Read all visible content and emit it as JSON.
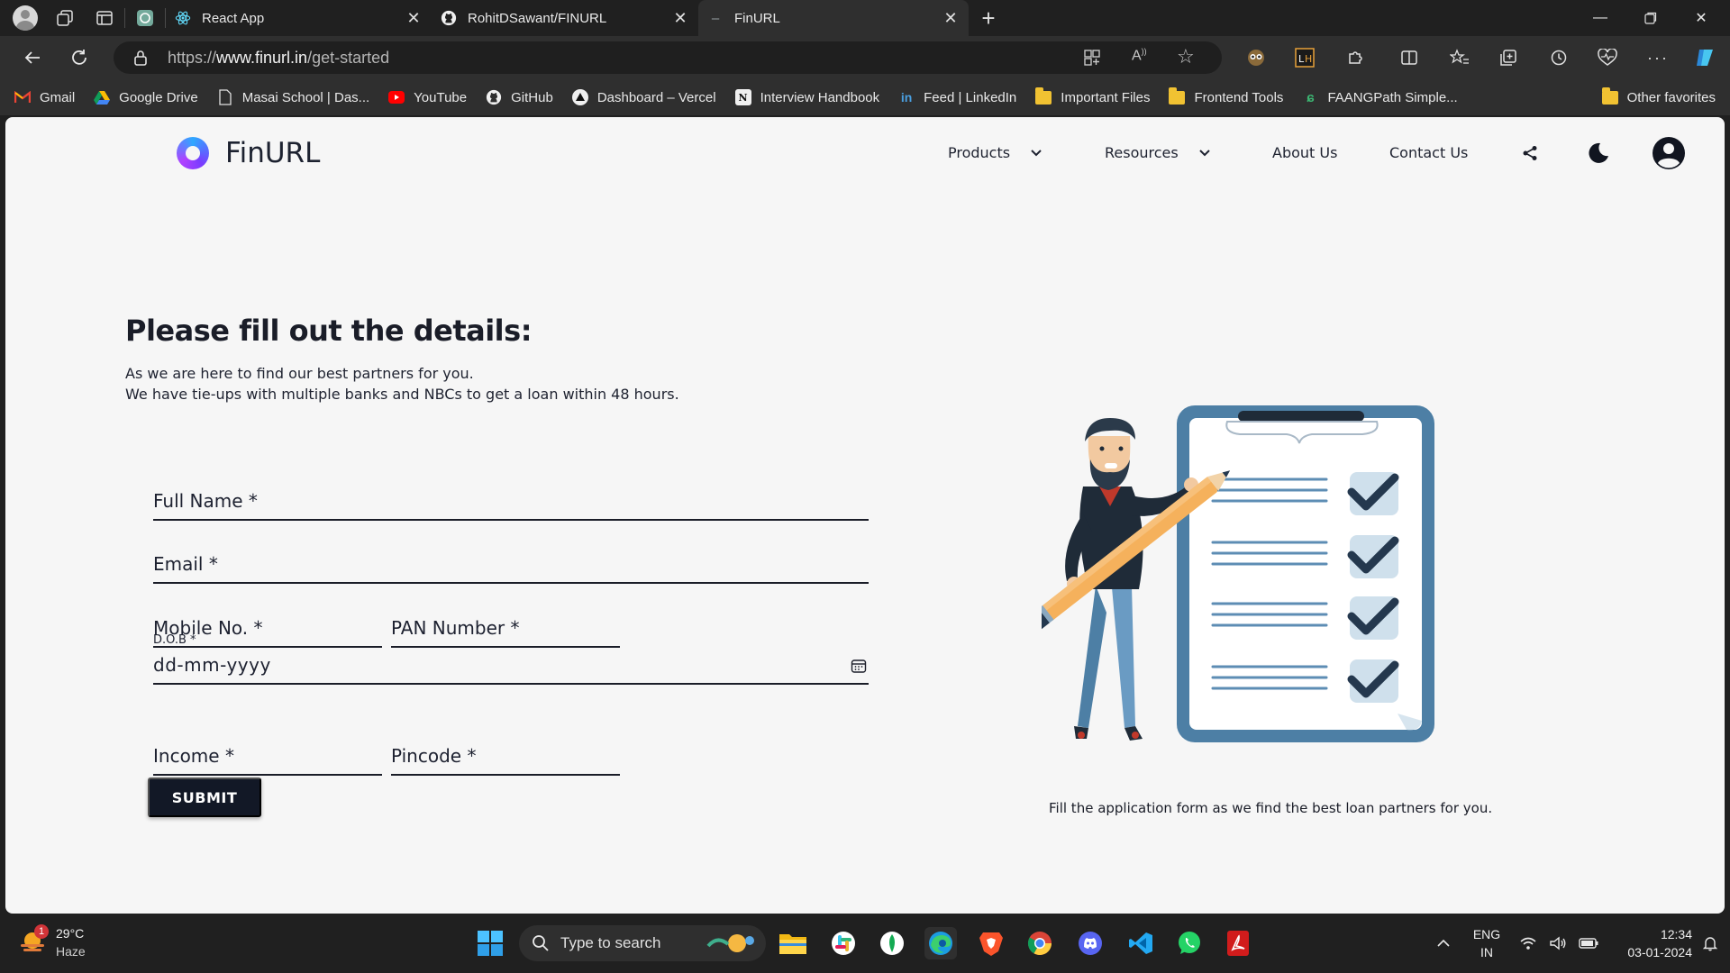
{
  "browser": {
    "tabs": [
      {
        "title": "React App"
      },
      {
        "title": "RohitDSawant/FINURL"
      },
      {
        "title": "FinURL"
      }
    ],
    "url_prefix": "https://",
    "url_domain": "www.finurl.in",
    "url_path": "/get-started",
    "bookmarks": [
      {
        "label": "Gmail"
      },
      {
        "label": "Google Drive"
      },
      {
        "label": "Masai School | Das..."
      },
      {
        "label": "YouTube"
      },
      {
        "label": "GitHub"
      },
      {
        "label": "Dashboard – Vercel"
      },
      {
        "label": "Interview Handbook"
      },
      {
        "label": "Feed | LinkedIn"
      },
      {
        "label": "Important Files"
      },
      {
        "label": "Frontend Tools"
      },
      {
        "label": "FAANGPath Simple..."
      }
    ],
    "other_favorites": "Other favorites"
  },
  "site": {
    "logo_text": "FinURL",
    "nav": {
      "products": "Products",
      "resources": "Resources",
      "about": "About Us",
      "contact": "Contact Us"
    }
  },
  "form": {
    "title": "Please fill out the details:",
    "desc_line1": "As we are here to find our best partners for you.",
    "desc_line2": "We have tie-ups with multiple banks and NBCs to get a loan within 48 hours.",
    "full_name": "Full Name *",
    "email": "Email *",
    "mobile": "Mobile No. *",
    "pan": "PAN Number *",
    "dob_label": "D.O.B *",
    "dob_placeholder": "dd-mm-yyyy",
    "income": "Income *",
    "pincode": "Pincode *",
    "submit": "SUBMIT"
  },
  "illustration": {
    "caption": "Fill the application form as we find the best loan partners for you."
  },
  "taskbar": {
    "weather_badge": "1",
    "temperature": "29°C",
    "weather": "Haze",
    "search_placeholder": "Type to search",
    "lang": "ENG",
    "region": "IN",
    "time": "12:34",
    "date": "03-01-2024"
  },
  "colors": {
    "page_bg": "#f6f6f6",
    "primary_dark": "#121826",
    "clipboard_blue": "#4d7fa5",
    "check_dark": "#24384e"
  }
}
